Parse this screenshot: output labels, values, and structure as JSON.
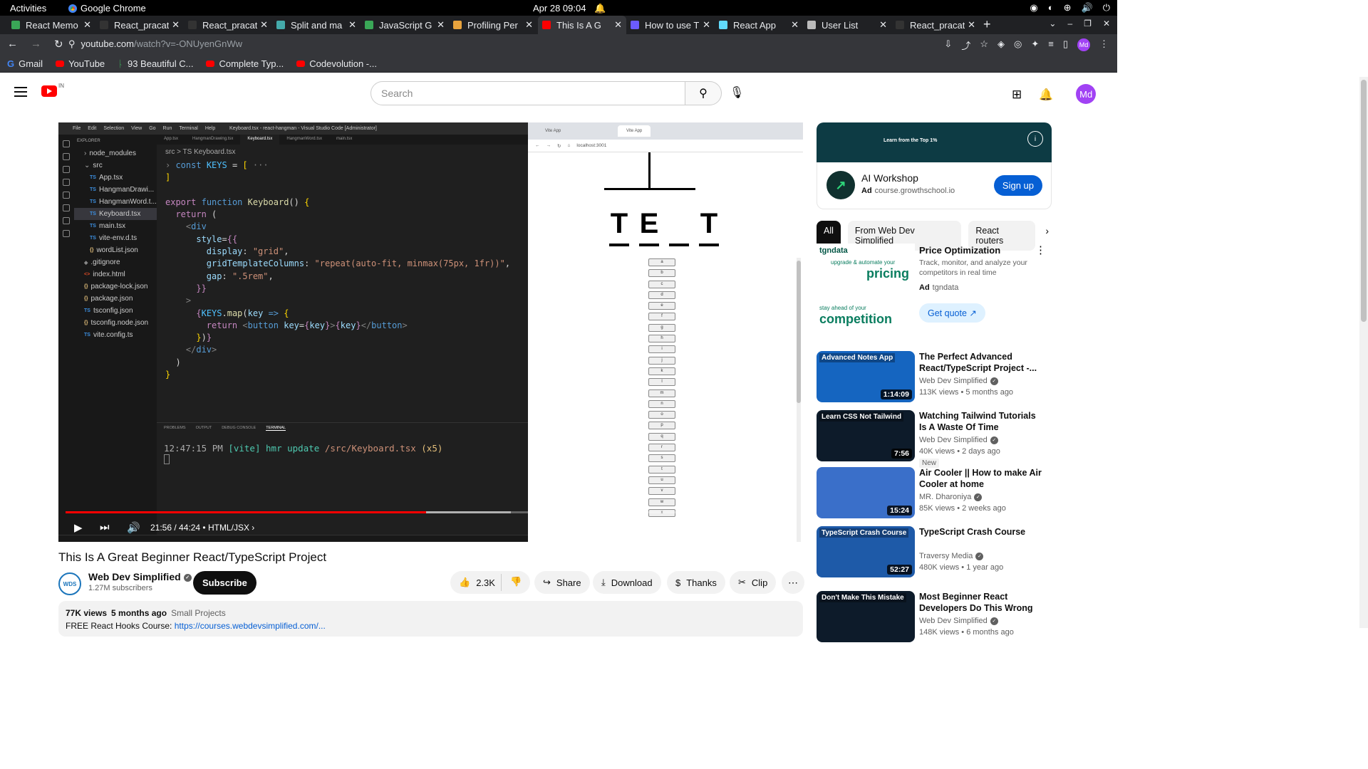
{
  "system": {
    "activities": "Activities",
    "app_name": "Google Chrome",
    "datetime": "Apr 28  09:04"
  },
  "tabs": [
    {
      "title": "React Memo",
      "color": "#3aa757"
    },
    {
      "title": "React_pracat",
      "color": "#333"
    },
    {
      "title": "React_pracat",
      "color": "#333"
    },
    {
      "title": "Split and ma",
      "color": "#4aa"
    },
    {
      "title": "JavaScript G",
      "color": "#3aa757"
    },
    {
      "title": "Profiling Per",
      "color": "#e8a33d"
    },
    {
      "title": "This Is A G",
      "color": "#f00"
    },
    {
      "title": "How to use T",
      "color": "#6b5bff"
    },
    {
      "title": "React App",
      "color": "#61dafb"
    },
    {
      "title": "User List",
      "color": "#bbb"
    },
    {
      "title": "React_pracat",
      "color": "#333"
    }
  ],
  "address": {
    "host": "youtube.com",
    "path": "/watch?v=-ONUyenGnWw",
    "avatar": "Md"
  },
  "bookmarks": [
    "Gmail",
    "YouTube",
    "93 Beautiful C...",
    "Complete Typ...",
    "Codevolution -..."
  ],
  "yt": {
    "region": "IN",
    "search_placeholder": "Search",
    "user_initials": "Md"
  },
  "video": {
    "vscode_title": "Keyboard.tsx - react-hangman - Visual Studio Code [Administrator]",
    "editor_tabs": [
      "App.tsx",
      "HangmanDrawing.tsx",
      "Keyboard.tsx",
      "HangmanWord.tsx",
      "main.tsx"
    ],
    "explorer_label": "EXPLORER",
    "files": [
      {
        "name": "node_modules",
        "type": "folder"
      },
      {
        "name": "src",
        "type": "folder"
      },
      {
        "name": "App.tsx",
        "type": "ts"
      },
      {
        "name": "HangmanDrawi...",
        "type": "ts"
      },
      {
        "name": "HangmanWord.t...",
        "type": "ts"
      },
      {
        "name": "Keyboard.tsx",
        "type": "ts"
      },
      {
        "name": "main.tsx",
        "type": "ts"
      },
      {
        "name": "vite-env.d.ts",
        "type": "ts"
      },
      {
        "name": "wordList.json",
        "type": "json"
      },
      {
        "name": ".gitignore",
        "type": "git"
      },
      {
        "name": "index.html",
        "type": "html"
      },
      {
        "name": "package-lock.json",
        "type": "json"
      },
      {
        "name": "package.json",
        "type": "json"
      },
      {
        "name": "tsconfig.json",
        "type": "ts"
      },
      {
        "name": "tsconfig.node.json",
        "type": "json"
      },
      {
        "name": "vite.config.ts",
        "type": "ts"
      }
    ],
    "breadcrumb": "src > TS Keyboard.tsx",
    "panel_tabs": [
      "PROBLEMS",
      "OUTPUT",
      "DEBUG CONSOLE",
      "TERMINAL"
    ],
    "terminal": {
      "time": "12:47:15 PM",
      "tag": "[vite]",
      "msg": "hmr update",
      "path": "/src/Keyboard.tsx",
      "count": "(x5)"
    },
    "browser_tabs": [
      "Vite App",
      "Vite App"
    ],
    "browser_url": "localhost:3001",
    "word_letters": [
      "T",
      "E",
      "",
      "T"
    ],
    "keys": [
      "a",
      "b",
      "c",
      "d",
      "e",
      "f",
      "g",
      "h",
      "i",
      "j",
      "k",
      "l",
      "m",
      "n",
      "o",
      "p",
      "q",
      "r",
      "s",
      "t",
      "u",
      "v",
      "w",
      "x"
    ],
    "time": "21:56 / 44:24",
    "chapter": "• HTML/JSX",
    "played_fraction": 0.494
  },
  "meta": {
    "title": "This Is A Great Beginner React/TypeScript Project",
    "channel": "Web Dev Simplified",
    "channel_logo": "WDS",
    "subscribers": "1.27M subscribers",
    "subscribe": "Subscribe",
    "likes": "2.3K",
    "share": "Share",
    "download": "Download",
    "thanks": "Thanks",
    "clip": "Clip",
    "views": "77K views",
    "age": "5 months ago",
    "category": "Small Projects",
    "desc_line": "FREE React Hooks Course:",
    "desc_link": "https://courses.webdevsimplified.com/..."
  },
  "sidebar": {
    "ad1": {
      "banner_text": "Learn from the Top 1%",
      "name": "AI Workshop",
      "ad_label": "Ad",
      "url": "course.growthschool.io",
      "cta": "Sign up"
    },
    "chips": [
      "All",
      "From Web Dev Simplified",
      "React routers"
    ],
    "ad2": {
      "brand": "tgndata",
      "line1": "upgrade & automate your",
      "big1": "pricing",
      "line2": "stay ahead of your",
      "big2": "competition",
      "title": "Price Optimization",
      "desc": "Track, monitor, and analyze your competitors in real time",
      "ad_label": "Ad",
      "advertiser": "tgndata",
      "cta": "Get quote"
    },
    "recs": [
      {
        "title": "The Perfect Advanced React/TypeScript Project -...",
        "channel": "Web Dev Simplified",
        "stats": "113K views • 5 months ago",
        "duration": "1:14:09",
        "thumb_text": "Advanced Notes App",
        "bg": "#1565c0",
        "badge": ""
      },
      {
        "title": "Watching Tailwind Tutorials Is A Waste Of Time",
        "channel": "Web Dev Simplified",
        "stats": "40K views • 2 days ago",
        "duration": "7:56",
        "thumb_text": "Learn CSS Not Tailwind",
        "bg": "#0d1b2a",
        "badge": "New"
      },
      {
        "title": "Air Cooler || How to make Air Cooler at home",
        "channel": "MR. Dharoniya",
        "stats": "85K views • 2 weeks ago",
        "duration": "15:24",
        "thumb_text": "",
        "bg": "#3a6fc9",
        "badge": ""
      },
      {
        "title": "TypeScript Crash Course",
        "channel": "Traversy Media",
        "stats": "480K views • 1 year ago",
        "duration": "52:27",
        "thumb_text": "TypeScript Crash Course",
        "bg": "#1e5aa8",
        "badge": ""
      },
      {
        "title": "Most Beginner React Developers Do This Wrong",
        "channel": "Web Dev Simplified",
        "stats": "148K views • 6 months ago",
        "duration": "",
        "thumb_text": "Don't Make This Mistake",
        "bg": "#0d1b2a",
        "badge": ""
      }
    ]
  }
}
